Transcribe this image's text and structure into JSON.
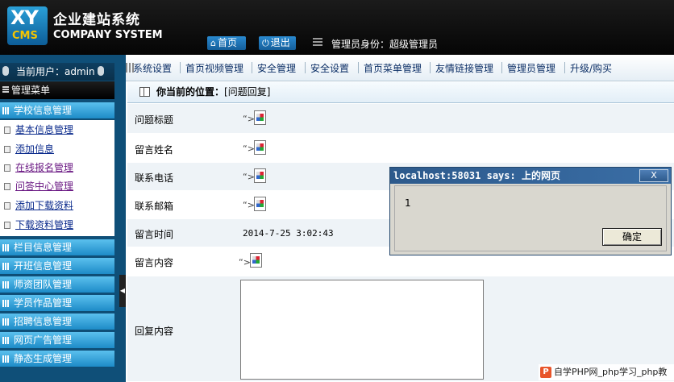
{
  "header": {
    "logo_xy": "XY",
    "logo_cms": "CMS",
    "title_cn": "企业建站系统",
    "title_en": "COMPANY SYSTEM",
    "home_label": "首页",
    "exit_label": "退出",
    "admin_role": "管理员身份：超级管理员"
  },
  "sidebar": {
    "current_user": "当前用户：admin",
    "menu_title": "管理菜单",
    "open_group": "学校信息管理",
    "sub_items": [
      "基本信息管理",
      "添加信息",
      "在线报名管理",
      "问答中心管理",
      "添加下载资料",
      "下载资料管理"
    ],
    "groups": [
      "栏目信息管理",
      "开班信息管理",
      "师资团队管理",
      "学员作品管理",
      "招聘信息管理",
      "网页广告管理",
      "静态生成管理"
    ]
  },
  "nav": {
    "items": [
      "系统设置",
      "首页视频管理",
      "安全管理",
      "安全设置",
      "首页菜单管理",
      "友情链接管理",
      "管理员管理",
      "升级/购买"
    ]
  },
  "breadcrumb": {
    "label": "你当前的位置：",
    "value": "[问题回复]"
  },
  "form": {
    "rows": [
      {
        "label": "问题标题"
      },
      {
        "label": "留言姓名"
      },
      {
        "label": "联系电话"
      },
      {
        "label": "联系邮箱"
      },
      {
        "label": "留言时间",
        "value": "2014-7-25 3:02:43"
      },
      {
        "label": "留言内容"
      }
    ],
    "reply_label": "回复内容",
    "reply_value": ""
  },
  "dialog": {
    "title": "localhost:58031 says: 上的网页",
    "close": "X",
    "message": "1",
    "ok": "确定"
  },
  "watermark": {
    "icon": "P",
    "text": "自学PHP网_php学习_php教"
  }
}
